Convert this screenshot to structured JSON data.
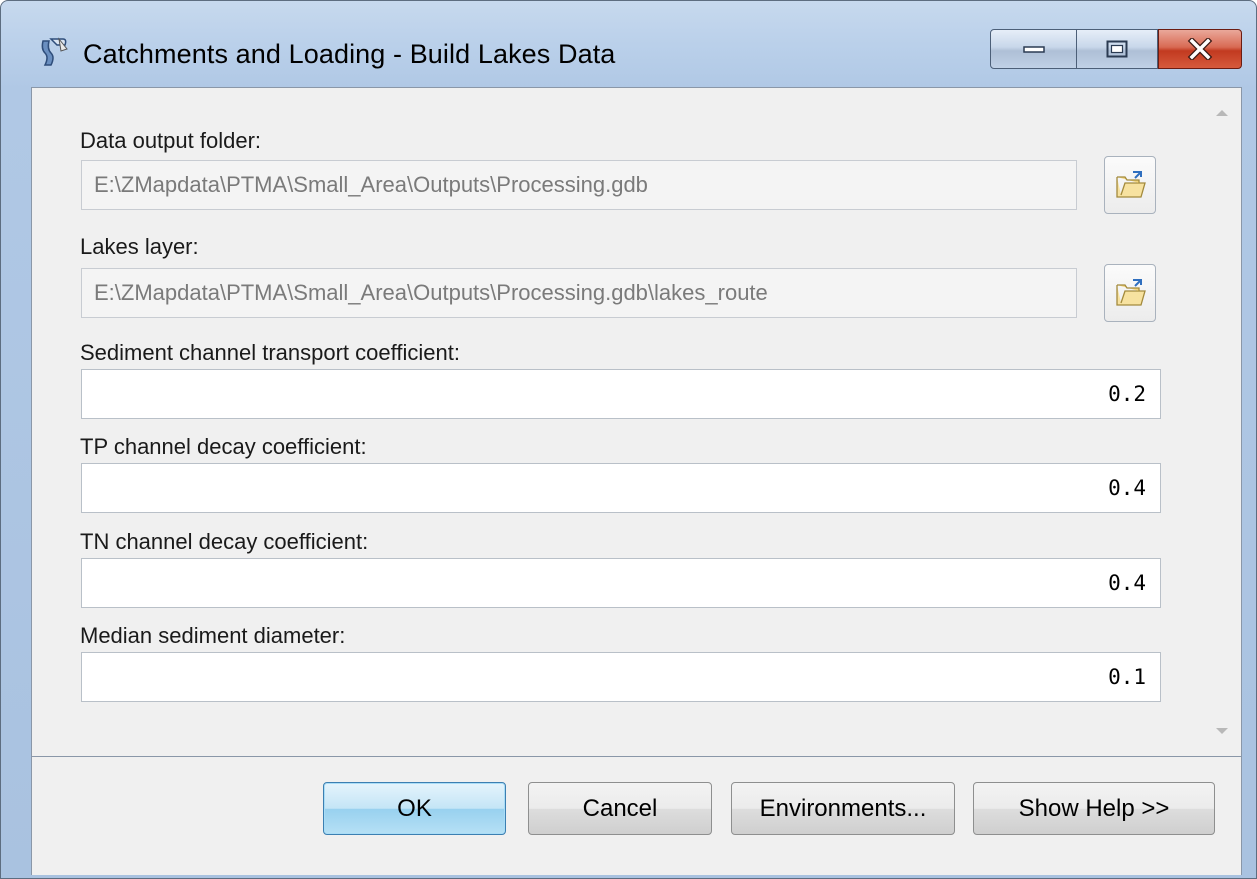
{
  "window": {
    "title": "Catchments and Loading - Build Lakes Data"
  },
  "fields": {
    "output_folder": {
      "label": "Data output folder:",
      "value": "E:\\ZMapdata\\PTMA\\Small_Area\\Outputs\\Processing.gdb"
    },
    "lakes_layer": {
      "label": "Lakes layer:",
      "value": "E:\\ZMapdata\\PTMA\\Small_Area\\Outputs\\Processing.gdb\\lakes_route"
    },
    "sediment_coeff": {
      "label": "Sediment channel transport coefficient:",
      "value": "0.2"
    },
    "tp_coeff": {
      "label": "TP channel decay coefficient:",
      "value": "0.4"
    },
    "tn_coeff": {
      "label": "TN channel decay coefficient:",
      "value": "0.4"
    },
    "median_diameter": {
      "label": "Median sediment diameter:",
      "value": "0.1"
    }
  },
  "buttons": {
    "ok": "OK",
    "cancel": "Cancel",
    "environments": "Environments...",
    "show_help": "Show Help >>"
  },
  "icons": {
    "app": "toolbox-script-icon",
    "browse": "folder-open-icon"
  },
  "colors": {
    "title_bar": "#b0c8e5",
    "close_button": "#c23a20",
    "ok_button": "#98d1ef",
    "dialog_bg": "#f0f0f0"
  }
}
